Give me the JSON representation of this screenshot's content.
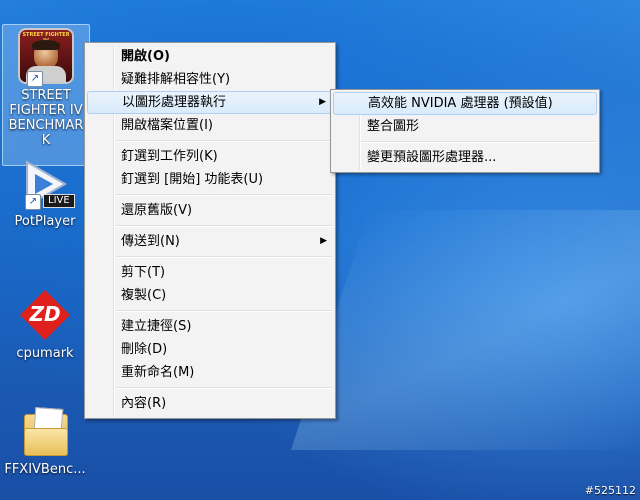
{
  "desktop_icons": [
    {
      "name": "sf4",
      "label": "STREET FIGHTER IV BENCHMARK",
      "title_art": "STREET FIGHTER IV"
    },
    {
      "name": "potplayer",
      "label": "PotPlayer",
      "badge": "LIVE"
    },
    {
      "name": "cpumark",
      "label": "cpumark",
      "logo_text": "ZD"
    },
    {
      "name": "ffxiv",
      "label": "FFXIVBenc..."
    }
  ],
  "context_menu": {
    "items": [
      {
        "label": "開啟(O)",
        "bold": true
      },
      {
        "label": "疑難排解相容性(Y)"
      },
      {
        "label": "以圖形處理器執行",
        "submenu": true,
        "highlighted": true
      },
      {
        "label": "開啟檔案位置(I)"
      },
      {
        "sep": true
      },
      {
        "label": "釘選到工作列(K)"
      },
      {
        "label": "釘選到 [開始] 功能表(U)"
      },
      {
        "sep": true
      },
      {
        "label": "還原舊版(V)"
      },
      {
        "sep": true
      },
      {
        "label": "傳送到(N)",
        "submenu": true
      },
      {
        "sep": true
      },
      {
        "label": "剪下(T)"
      },
      {
        "label": "複製(C)"
      },
      {
        "sep": true
      },
      {
        "label": "建立捷徑(S)"
      },
      {
        "label": "刪除(D)"
      },
      {
        "label": "重新命名(M)"
      },
      {
        "sep": true
      },
      {
        "label": "內容(R)"
      }
    ]
  },
  "submenu": {
    "items": [
      {
        "label": "高效能 NVIDIA 處理器 (預設值)",
        "highlighted": true
      },
      {
        "label": "整合圖形"
      },
      {
        "sep": true
      },
      {
        "label": "變更預設圖形處理器..."
      }
    ]
  },
  "arrow_glyph": "▶",
  "shortcut_glyph": "↗",
  "watermark": "#525112",
  "colors": {
    "highlight_border": "#aecff7",
    "menu_bg": "#f3f3f3",
    "desktop_blue": "#1f6fc9"
  }
}
